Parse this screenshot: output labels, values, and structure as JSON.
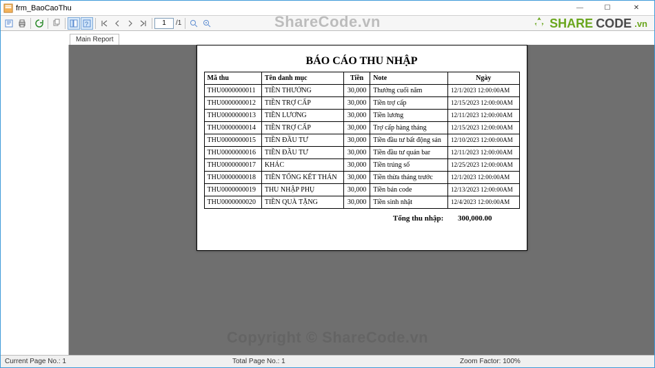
{
  "window": {
    "title": "frm_BaoCaoThu",
    "min_label": "—",
    "max_label": "☐",
    "close_label": "✕"
  },
  "toolbar": {
    "page_input": "1",
    "page_total": "/1"
  },
  "tabs": {
    "main": "Main Report"
  },
  "report": {
    "title": "BÁO CÁO THU NHẬP",
    "headers": {
      "c0": "Mã thu",
      "c1": "Tên danh mục",
      "c2": "Tiền",
      "c3": "Note",
      "c4": "Ngày"
    },
    "rows": [
      {
        "id": "THU0000000011",
        "cat": "TIỀN THƯỞNG",
        "amt": "30,000",
        "note": "Thưởng cuối năm",
        "date": "12/1/2023  12:00:00AM"
      },
      {
        "id": "THU0000000012",
        "cat": "TIỀN TRỢ CẤP",
        "amt": "30,000",
        "note": "Tiền trợ cấp",
        "date": "12/15/2023  12:00:00AM"
      },
      {
        "id": "THU0000000013",
        "cat": "TIỀN LƯƠNG",
        "amt": "30,000",
        "note": "Tiền lương",
        "date": "12/11/2023  12:00:00AM"
      },
      {
        "id": "THU0000000014",
        "cat": "TIỀN TRỢ CẤP",
        "amt": "30,000",
        "note": "Trợ cấp hàng tháng",
        "date": "12/15/2023  12:00:00AM"
      },
      {
        "id": "THU0000000015",
        "cat": "TIỀN ĐẦU TƯ",
        "amt": "30,000",
        "note": "Tiền đầu tư bất động sản",
        "date": "12/10/2023  12:00:00AM"
      },
      {
        "id": "THU0000000016",
        "cat": "TIỀN ĐẦU TƯ",
        "amt": "30,000",
        "note": "Tiền đầu tư quán bar",
        "date": "12/11/2023  12:00:00AM"
      },
      {
        "id": "THU0000000017",
        "cat": "KHÁC",
        "amt": "30,000",
        "note": "Tiền trúng số",
        "date": "12/25/2023  12:00:00AM"
      },
      {
        "id": "THU0000000018",
        "cat": "TIỀN TỔNG KẾT THÁN",
        "amt": "30,000",
        "note": "Tiền thừa tháng trước",
        "date": "12/1/2023  12:00:00AM"
      },
      {
        "id": "THU0000000019",
        "cat": "THU NHẬP PHỤ",
        "amt": "30,000",
        "note": "Tiền bán code",
        "date": "12/13/2023  12:00:00AM"
      },
      {
        "id": "THU0000000020",
        "cat": "TIỀN QUÀ TẶNG",
        "amt": "30,000",
        "note": "Tiền sinh nhật",
        "date": "12/4/2023  12:00:00AM"
      }
    ],
    "total_label": "Tổng thu nhập:",
    "total_value": "300,000.00"
  },
  "watermark": {
    "top": "ShareCode.vn",
    "bottom": "Copyright © ShareCode.vn"
  },
  "logo": {
    "p1": "SHARE",
    "p2": "CODE",
    "p3": ".vn"
  },
  "status": {
    "current_label": "Current Page No.:",
    "current_val": "1",
    "total_label": "Total Page No.:",
    "total_val": "1",
    "zoom_label": "Zoom Factor:",
    "zoom_val": "100%"
  }
}
